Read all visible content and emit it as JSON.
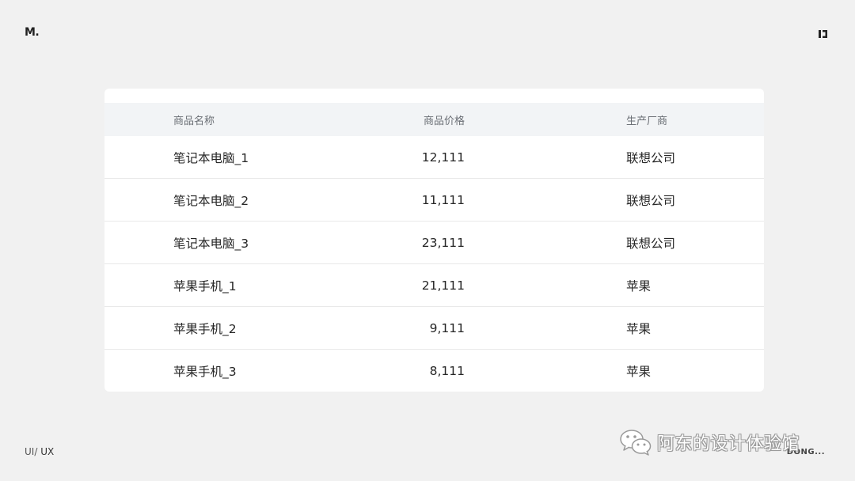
{
  "brand": {
    "logo_text": "M."
  },
  "corner": {
    "icon": "bracket-square-icon"
  },
  "table": {
    "headers": {
      "name": "商品名称",
      "price": "商品价格",
      "maker": "生产厂商"
    },
    "rows": [
      {
        "name": "笔记本电脑_1",
        "price": "12,111",
        "maker": "联想公司"
      },
      {
        "name": "笔记本电脑_2",
        "price": "11,111",
        "maker": "联想公司"
      },
      {
        "name": "笔记本电脑_3",
        "price": "23,111",
        "maker": "联想公司"
      },
      {
        "name": "苹果手机_1",
        "price": "21,111",
        "maker": "苹果"
      },
      {
        "name": "苹果手机_2",
        "price": "9,111",
        "maker": "苹果"
      },
      {
        "name": "苹果手机_3",
        "price": "8,111",
        "maker": "苹果"
      }
    ]
  },
  "footer": {
    "left_ui": "UI/",
    "left_ux": " UX",
    "watermark_text": "阿东的设计体验馆",
    "watermark_icon": "wechat-icon",
    "right_text": "DONG..."
  }
}
